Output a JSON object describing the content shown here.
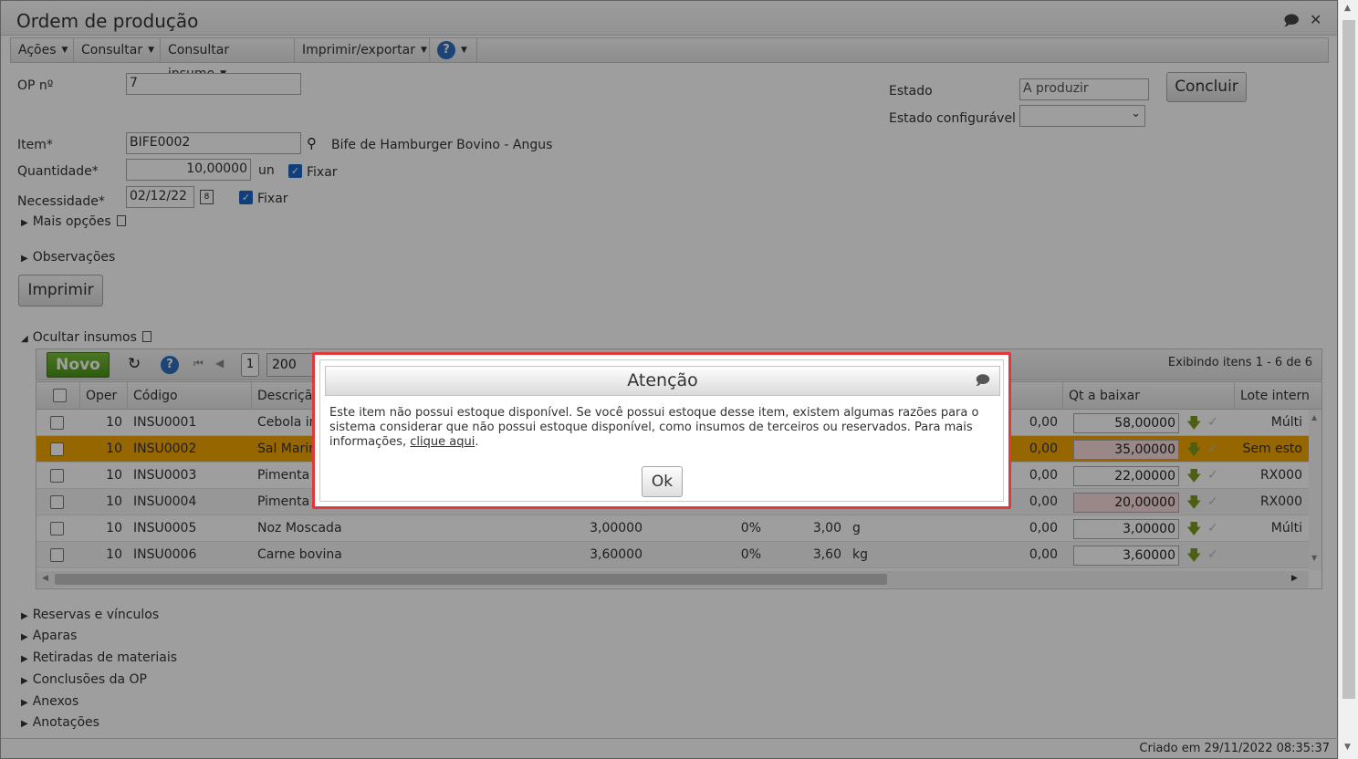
{
  "window": {
    "title": "Ordem de produção"
  },
  "menubar": {
    "items": [
      "Ações",
      "Consultar",
      "Consultar insumo",
      "Imprimir/exportar"
    ]
  },
  "form": {
    "op_label": "OP nº",
    "op_value": "7",
    "item_label": "Item*",
    "item_value": "BIFE0002",
    "item_desc": "Bife de Hamburger Bovino - Angus",
    "qty_label": "Quantidade*",
    "qty_value": "10,00000",
    "qty_unit": "un",
    "qty_fix_label": "Fixar",
    "need_label": "Necessidade*",
    "need_value": "02/12/22",
    "need_fix_label": "Fixar",
    "more_options": "Mais opções",
    "observations": "Observações",
    "print_button": "Imprimir",
    "state_label": "Estado",
    "state_value": "A produzir",
    "config_state_label": "Estado configurável",
    "conclude_button": "Concluir"
  },
  "inputs_section": {
    "toggle_label": "Ocultar insumos",
    "new_button": "Novo",
    "page": "1",
    "page_size": "200",
    "display_info": "Exibindo itens 1 - 6 de 6",
    "columns": {
      "oper": "Oper",
      "code": "Código",
      "desc": "Descriçã",
      "qt_baixar": "Qt a baixar",
      "lote": "Lote intern"
    },
    "rows": [
      {
        "oper": "10",
        "code": "INSU0001",
        "desc": "Cebola in",
        "qty": "",
        "pct": "",
        "amt": "",
        "unit": "",
        "baixado": "0,00",
        "qt_baixar": "58,00000",
        "lote": "Múlti",
        "pink": false
      },
      {
        "oper": "10",
        "code": "INSU0002",
        "desc": "Sal Marin",
        "qty": "",
        "pct": "",
        "amt": "",
        "unit": "",
        "baixado": "0,00",
        "qt_baixar": "35,00000",
        "lote": "Sem esto",
        "pink": true
      },
      {
        "oper": "10",
        "code": "INSU0003",
        "desc": "Pimenta",
        "qty": "",
        "pct": "",
        "amt": "",
        "unit": "",
        "baixado": "0,00",
        "qt_baixar": "22,00000",
        "lote": "RX000",
        "pink": false
      },
      {
        "oper": "10",
        "code": "INSU0004",
        "desc": "Pimenta",
        "qty": "",
        "pct": "",
        "amt": "",
        "unit": "",
        "baixado": "0,00",
        "qt_baixar": "20,00000",
        "lote": "RX000",
        "pink": true
      },
      {
        "oper": "10",
        "code": "INSU0005",
        "desc": "Noz Moscada",
        "qty": "3,00000",
        "pct": "0%",
        "amt": "3,00",
        "unit": "g",
        "baixado": "0,00",
        "qt_baixar": "3,00000",
        "lote": "Múlti",
        "pink": false
      },
      {
        "oper": "10",
        "code": "INSU0006",
        "desc": "Carne bovina",
        "qty": "3,60000",
        "pct": "0%",
        "amt": "3,60",
        "unit": "kg",
        "baixado": "0,00",
        "qt_baixar": "3,60000",
        "lote": "",
        "pink": false
      }
    ]
  },
  "sections": [
    "Reservas e vínculos",
    "Aparas",
    "Retiradas de materiais",
    "Conclusões da OP",
    "Anexos",
    "Anotações"
  ],
  "footer": {
    "created": "Criado em 29/11/2022 08:35:37"
  },
  "dialog": {
    "title": "Atenção",
    "message": "Este item não possui estoque disponível. Se você possui estoque desse item, existem algumas razões para o sistema considerar que não possui estoque disponível, como insumos de terceiros ou reservados. Para mais informações, ",
    "link": "clique aqui",
    "message_end": ".",
    "ok_button": "Ok"
  },
  "colors": {
    "selected_row": "#f2a500",
    "new_button": "#5aa324",
    "dialog_border": "#e0393b",
    "pink_cell": "#f8dada"
  }
}
